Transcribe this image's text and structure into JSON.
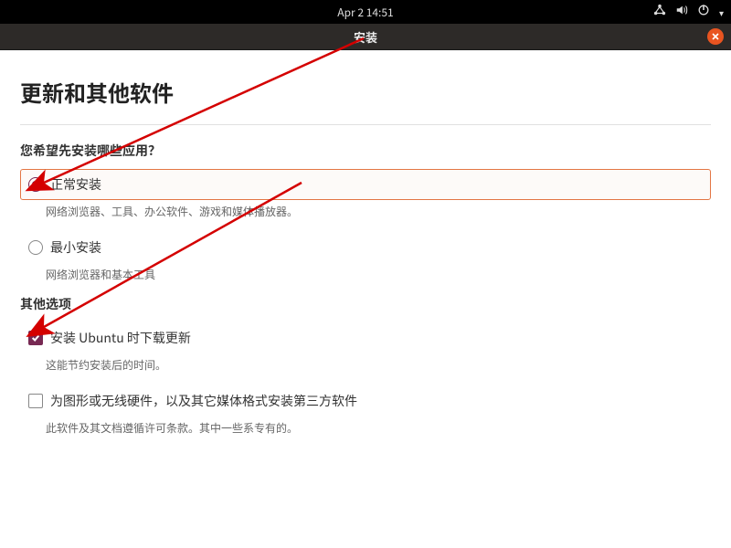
{
  "topbar": {
    "datetime": "Apr 2  14:51"
  },
  "window": {
    "title": "安装"
  },
  "page": {
    "heading": "更新和其他软件",
    "question": "您希望先安装哪些应用？",
    "options": {
      "normal": {
        "label": "正常安装",
        "desc": "网络浏览器、工具、办公软件、游戏和媒体播放器。"
      },
      "minimal": {
        "label": "最小安装",
        "desc": "网络浏览器和基本工具"
      }
    },
    "other_section": "其他选项",
    "other": {
      "download_updates": {
        "label": "安装 Ubuntu 时下载更新",
        "desc": "这能节约安装后的时间。"
      },
      "third_party": {
        "label": "为图形或无线硬件，以及其它媒体格式安装第三方软件",
        "desc": "此软件及其文档遵循许可条款。其中一些系专有的。"
      }
    }
  }
}
